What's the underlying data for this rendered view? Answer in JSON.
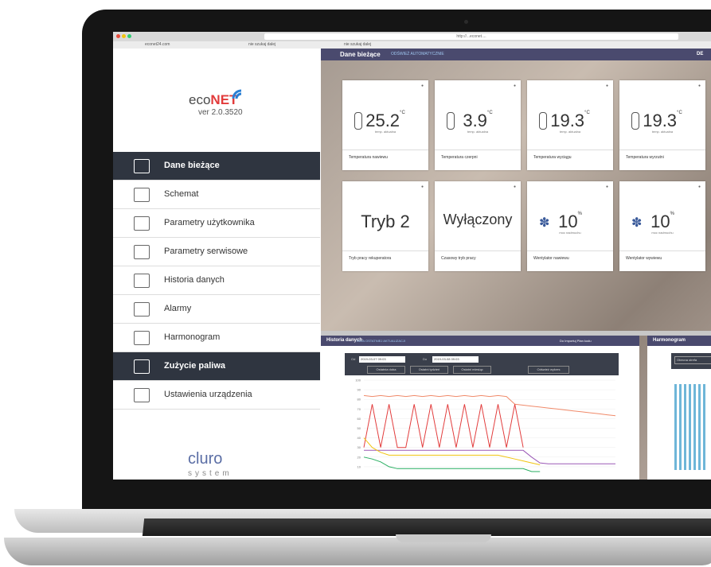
{
  "browser": {
    "url": "http://...econet....",
    "tabs": [
      "econet24.com",
      "nie szukaj dalej",
      "nie szukaj dalej"
    ]
  },
  "sidebar": {
    "logo": {
      "eco": "eco",
      "net": "NET"
    },
    "version": "ver 2.0.3520",
    "items": [
      {
        "label": "Dane bieżące",
        "icon": "house-icon",
        "active": true
      },
      {
        "label": "Schemat",
        "icon": "schema-icon",
        "active": false
      },
      {
        "label": "Parametry użytkownika",
        "icon": "user-params-icon",
        "active": false
      },
      {
        "label": "Parametry serwisowe",
        "icon": "service-params-icon",
        "active": false
      },
      {
        "label": "Historia danych",
        "icon": "history-icon",
        "active": false
      },
      {
        "label": "Alarmy",
        "icon": "alarm-icon",
        "active": false
      },
      {
        "label": "Harmonogram",
        "icon": "schedule-icon",
        "active": false
      },
      {
        "label": "Zużycie paliwa",
        "icon": "fuel-usage-icon",
        "active": true
      },
      {
        "label": "Ustawienia urządzenia",
        "icon": "device-settings-icon",
        "active": false
      }
    ],
    "brand": "cluro",
    "brand_sub": "system"
  },
  "main": {
    "title": "Dane bieżące",
    "subtitle": "ODŚWIEŻ AUTOMATYCZNIE",
    "right": "DE",
    "tiles": [
      {
        "value": "25.2",
        "unit": "°C",
        "sub": "temp. aktualna",
        "caption": "Temperatura nawiewu",
        "icon": "thermometer-icon"
      },
      {
        "value": "3.9",
        "unit": "°C",
        "sub": "temp. aktualna",
        "caption": "Temperatura czerpni",
        "icon": "thermometer-icon"
      },
      {
        "value": "19.3",
        "unit": "°C",
        "sub": "temp. aktualna",
        "caption": "Temperatura wyciągu",
        "icon": "thermometer-icon"
      },
      {
        "value": "19.3",
        "unit": "°C",
        "sub": "temp. aktualna",
        "caption": "Temperatura wyrzutni",
        "icon": "thermometer-icon"
      },
      {
        "value": "Tryb 2",
        "unit": "",
        "sub": "",
        "caption": "Tryb pracy rekuperatora",
        "icon": ""
      },
      {
        "value": "Wyłączony",
        "unit": "",
        "sub": "",
        "caption": "Czasowy tryb pracy",
        "icon": ""
      },
      {
        "value": "10",
        "unit": "%",
        "sub": "moc nadmuchu",
        "caption": "Wentylator nawiewu",
        "icon": "fan-icon"
      },
      {
        "value": "10",
        "unit": "%",
        "sub": "moc nadmuchu",
        "caption": "Wentylator wywiewu",
        "icon": "fan-icon"
      }
    ]
  },
  "history": {
    "title": "Historia danych",
    "subtitle": "DATA OSTATNIEJ AKTUALIZACJI",
    "right": "Do Importuj  Plan kodu",
    "from_label": "Od",
    "from_value": "2019-03-07 09:03",
    "to_label": "Do",
    "to_value": "2019-03-08 09:03",
    "buttons": [
      "Ostatnia doba",
      "Ostatni tydzień",
      "Ostatni miesiąc",
      "Odśwież wykres"
    ],
    "y_ticks": [
      "100",
      "90",
      "80",
      "70",
      "60",
      "50",
      "40",
      "30",
      "20",
      "10"
    ]
  },
  "harmonogram": {
    "title": "Harmonogram",
    "button": "Obecna strefa"
  },
  "chart_data": {
    "type": "line",
    "x": [
      0,
      1,
      2,
      3,
      4,
      5,
      6,
      7,
      8,
      9,
      10,
      11,
      12,
      13,
      14,
      15,
      16,
      17,
      18,
      19,
      20,
      21,
      22,
      23,
      24,
      25,
      26,
      27,
      28,
      29,
      30
    ],
    "series": [
      {
        "color": "#f08a6a",
        "values": [
          84,
          83,
          84,
          83,
          84,
          83,
          84,
          83,
          84,
          83,
          84,
          83,
          84,
          83,
          84,
          83,
          84,
          83,
          75,
          74,
          73,
          72,
          71,
          70,
          69,
          68,
          67,
          66,
          65,
          64,
          63
        ]
      },
      {
        "color": "#e23b3b",
        "values": [
          30,
          75,
          30,
          75,
          30,
          30,
          75,
          30,
          75,
          30,
          75,
          30,
          75,
          30,
          75,
          30,
          75,
          30,
          75,
          30,
          null,
          null,
          null,
          null,
          null,
          null,
          null,
          null,
          null,
          null,
          null
        ]
      },
      {
        "color": "#9b59b6",
        "values": [
          27,
          27,
          27,
          27,
          27,
          27,
          27,
          27,
          27,
          27,
          27,
          27,
          27,
          27,
          27,
          27,
          27,
          27,
          27,
          27,
          20,
          14,
          13,
          13,
          13,
          13,
          13,
          13,
          13,
          13,
          13
        ]
      },
      {
        "color": "#f1c40f",
        "values": [
          40,
          30,
          25,
          22,
          22,
          22,
          22,
          22,
          22,
          22,
          22,
          22,
          22,
          22,
          22,
          22,
          22,
          20,
          18,
          16,
          14,
          12,
          null,
          null,
          null,
          null,
          null,
          null,
          null,
          null,
          null
        ]
      },
      {
        "color": "#27ae60",
        "values": [
          20,
          18,
          15,
          10,
          8,
          8,
          8,
          8,
          8,
          8,
          8,
          8,
          8,
          8,
          8,
          8,
          8,
          8,
          8,
          8,
          5,
          5,
          null,
          null,
          null,
          null,
          null,
          null,
          null,
          null,
          null
        ]
      }
    ],
    "ylim": [
      0,
      100
    ]
  }
}
